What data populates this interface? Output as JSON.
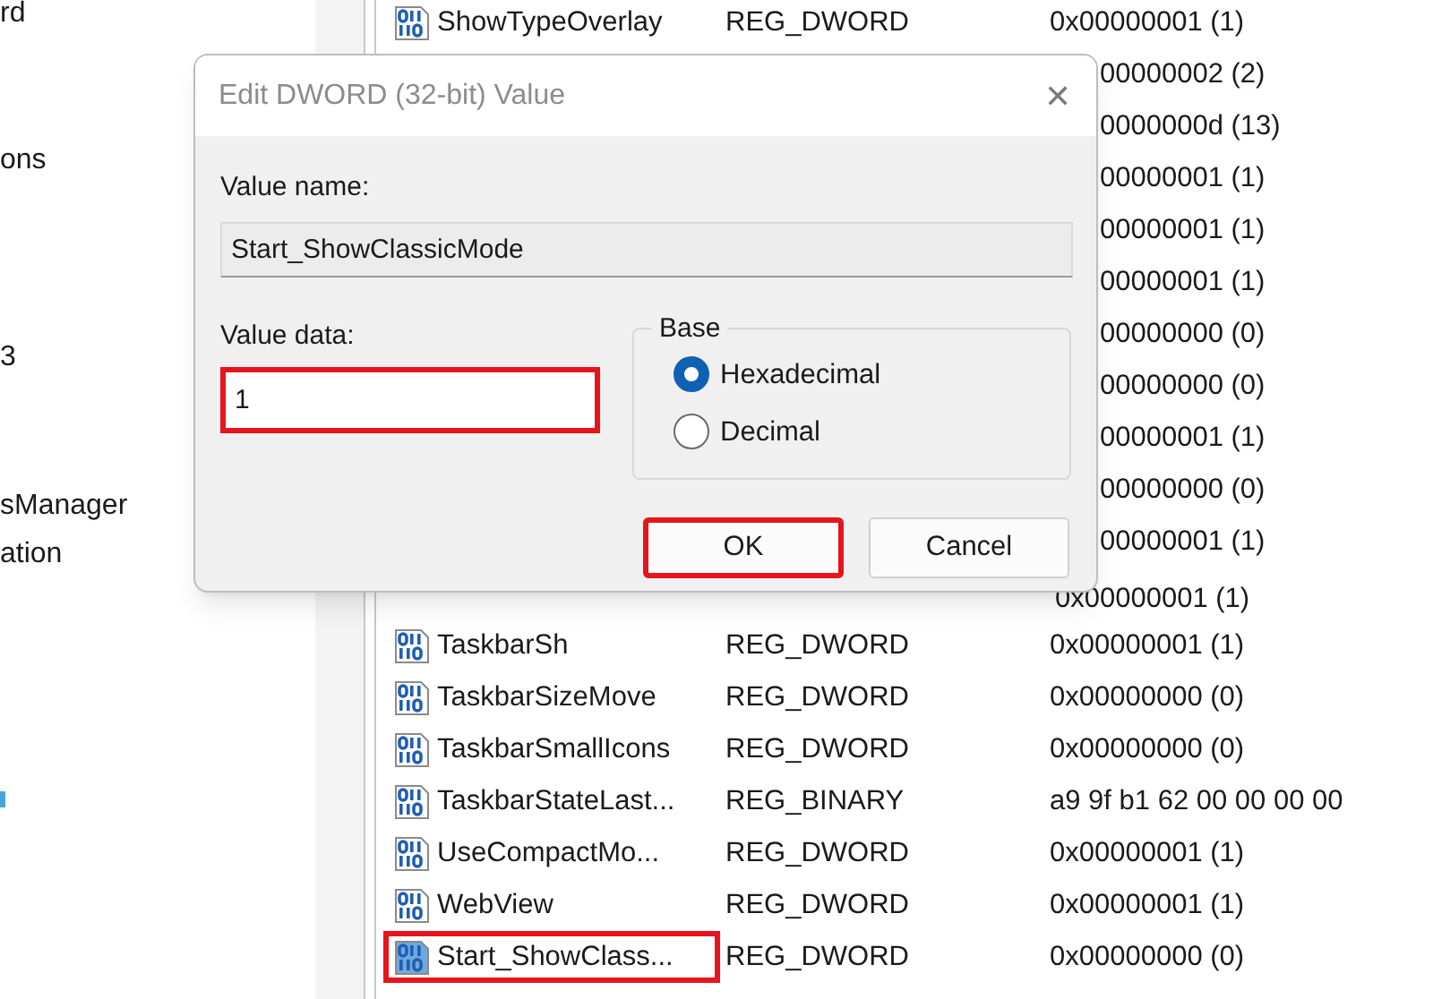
{
  "tree_items": [
    {
      "label": "rd"
    },
    {
      "label": "ons"
    },
    {
      "label": "3"
    },
    {
      "label": "sManager"
    },
    {
      "label": "ation"
    }
  ],
  "values": [
    {
      "kind": "full",
      "name": "ShowTypeOverlay",
      "type": "REG_DWORD",
      "data": "0x00000001 (1)",
      "selected": false
    },
    {
      "kind": "covered",
      "data": "00000002 (2)"
    },
    {
      "kind": "covered",
      "data": "0000000d (13)"
    },
    {
      "kind": "covered",
      "data": "00000001 (1)"
    },
    {
      "kind": "covered",
      "data": "00000001 (1)"
    },
    {
      "kind": "covered",
      "data": "00000001 (1)"
    },
    {
      "kind": "covered",
      "data": "00000000 (0)"
    },
    {
      "kind": "covered",
      "data": "00000000 (0)"
    },
    {
      "kind": "covered",
      "data": "00000001 (1)"
    },
    {
      "kind": "covered",
      "data": "00000000 (0)"
    },
    {
      "kind": "covered",
      "data": "00000001 (1)"
    },
    {
      "kind": "data_only",
      "data": "0x00000001 (1)"
    },
    {
      "kind": "full",
      "name": "TaskbarSh",
      "type": "REG_DWORD",
      "data": "0x00000001 (1)",
      "selected": false
    },
    {
      "kind": "full",
      "name": "TaskbarSizeMove",
      "type": "REG_DWORD",
      "data": "0x00000000 (0)",
      "selected": false
    },
    {
      "kind": "full",
      "name": "TaskbarSmallIcons",
      "type": "REG_DWORD",
      "data": "0x00000000 (0)",
      "selected": false
    },
    {
      "kind": "full",
      "name": "TaskbarStateLast...",
      "type": "REG_BINARY",
      "data": "a9 9f b1 62 00 00 00 00",
      "selected": false
    },
    {
      "kind": "full",
      "name": "UseCompactMo...",
      "type": "REG_DWORD",
      "data": "0x00000001 (1)",
      "selected": false
    },
    {
      "kind": "full",
      "name": "WebView",
      "type": "REG_DWORD",
      "data": "0x00000001 (1)",
      "selected": false
    },
    {
      "kind": "full",
      "name": "Start_ShowClass...",
      "type": "REG_DWORD",
      "data": "0x00000000 (0)",
      "selected": true
    }
  ],
  "dialog": {
    "title": "Edit DWORD (32-bit) Value",
    "close": "✕",
    "value_name_label": "Value name:",
    "value_name": "Start_ShowClassicMode",
    "value_data_label": "Value data:",
    "value_data": "1",
    "value_data_highlighted": true,
    "base_label": "Base",
    "bases": [
      {
        "label": "Hexadecimal",
        "selected": true
      },
      {
        "label": "Decimal",
        "selected": false
      }
    ],
    "buttons": [
      {
        "label": "OK",
        "highlighted": true
      },
      {
        "label": "Cancel",
        "highlighted": false
      }
    ]
  }
}
